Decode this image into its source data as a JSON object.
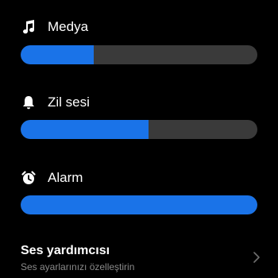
{
  "sliders": [
    {
      "icon": "music-note-icon",
      "label": "Medya",
      "level_percent": 31
    },
    {
      "icon": "bell-icon",
      "label": "Zil sesi",
      "level_percent": 54
    },
    {
      "icon": "alarm-clock-icon",
      "label": "Alarm",
      "level_percent": 100
    }
  ],
  "assistant": {
    "title": "Ses yardımcısı",
    "subtitle": "Ses ayarlarınızı özelleştirin"
  },
  "colors": {
    "accent": "#1a73e8",
    "track": "#3a3a3a",
    "background": "#000000",
    "subtitle": "#8a8a8a"
  }
}
